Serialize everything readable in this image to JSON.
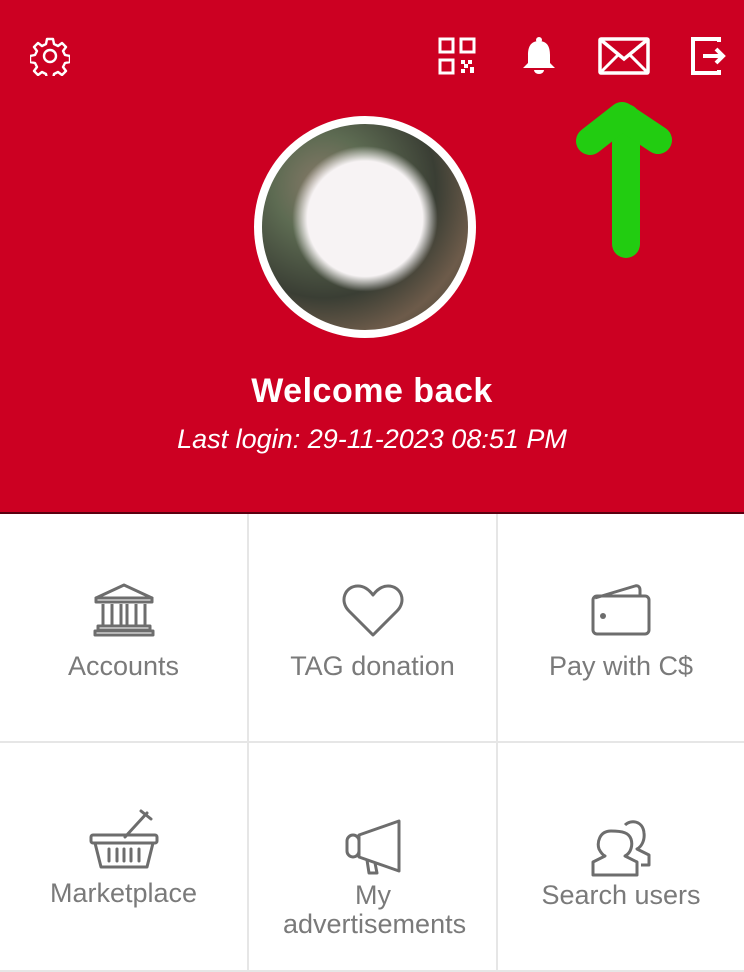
{
  "header": {
    "icons": {
      "settings": "gear-icon",
      "qr": "qr-code-icon",
      "notifications": "bell-icon",
      "messages": "envelope-icon",
      "logout": "logout-icon"
    },
    "welcome_title": "Welcome back",
    "last_login": "Last login: 29-11-2023 08:51 PM",
    "annotation": "green-up-arrow pointing to envelope icon"
  },
  "menu": {
    "items": [
      {
        "label": "Accounts",
        "icon": "bank-icon"
      },
      {
        "label": "TAG donation",
        "icon": "heart-icon"
      },
      {
        "label": "Pay with C$",
        "icon": "wallet-icon"
      },
      {
        "label": "Marketplace",
        "icon": "basket-icon"
      },
      {
        "label": "My advertisements",
        "icon": "megaphone-icon"
      },
      {
        "label": "Search users",
        "icon": "users-icon"
      }
    ]
  },
  "colors": {
    "header_bg": "#cc0022",
    "text_on_header": "#ffffff",
    "menu_text": "#7a7a7a",
    "menu_icon": "#6d6d6d",
    "annotation_arrow": "#22cc11",
    "grid_border": "#e6e6e6"
  }
}
